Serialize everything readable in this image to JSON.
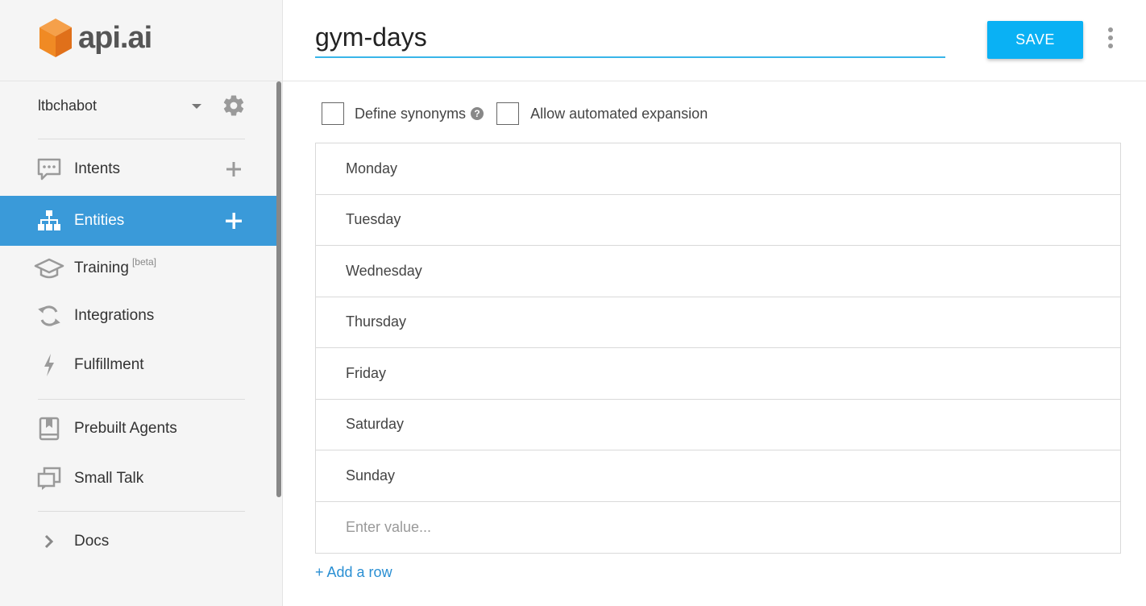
{
  "brand": {
    "name": "api.ai"
  },
  "agent": {
    "name": "ltbchabot"
  },
  "nav": {
    "intents": "Intents",
    "entities": "Entities",
    "training": "Training",
    "training_badge": "[beta]",
    "integrations": "Integrations",
    "fulfillment": "Fulfillment",
    "prebuilt_agents": "Prebuilt Agents",
    "small_talk": "Small Talk",
    "docs": "Docs"
  },
  "entity": {
    "name": "gym-days",
    "save_label": "SAVE",
    "define_synonyms_label": "Define synonyms",
    "allow_expansion_label": "Allow automated expansion",
    "define_synonyms_checked": false,
    "allow_expansion_checked": false,
    "rows": [
      "Monday",
      "Tuesday",
      "Wednesday",
      "Thursday",
      "Friday",
      "Saturday",
      "Sunday"
    ],
    "new_value_placeholder": "Enter value...",
    "add_row_label": "+ Add a row"
  },
  "colors": {
    "accent": "#0ab1f4",
    "active_nav": "#3a9ad9",
    "input_underline": "#39b5e9",
    "link": "#2a8fd3",
    "logo_orange": "#f08a24"
  },
  "icons": {
    "intents": "speech-bubble-icon",
    "entities": "hierarchy-icon",
    "training": "graduation-cap-icon",
    "integrations": "refresh-icon",
    "fulfillment": "lightning-icon",
    "prebuilt_agents": "book-icon",
    "small_talk": "chat-windows-icon",
    "docs": "chevron-right-icon"
  }
}
